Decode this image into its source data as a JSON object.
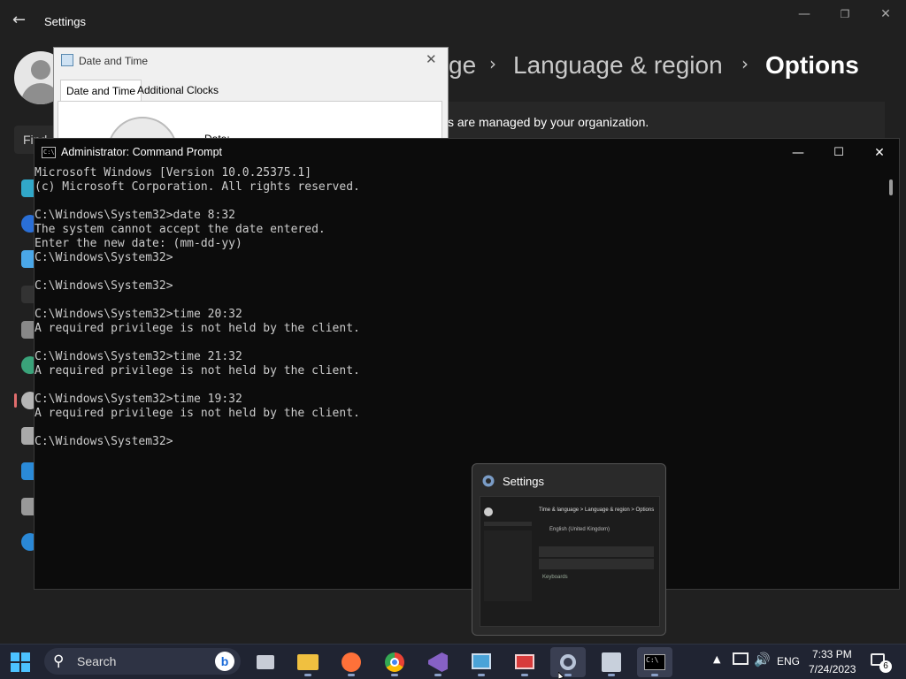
{
  "settings": {
    "app_title": "Settings",
    "find_placeholder": "Find",
    "breadcrumb": [
      "ge",
      "Language & region",
      "Options"
    ],
    "org_message": "s are managed by your organization."
  },
  "datetime_dialog": {
    "title": "Date and Time",
    "tabs": [
      "Date and Time",
      "Additional Clocks"
    ],
    "date_label": "Date:"
  },
  "cmd": {
    "title": "Administrator: Command Prompt",
    "icon_text": "C:\\",
    "lines": [
      "Microsoft Windows [Version 10.0.25375.1]",
      "(c) Microsoft Corporation. All rights reserved.",
      "",
      "C:\\Windows\\System32>date 8:32",
      "The system cannot accept the date entered.",
      "Enter the new date: (mm-dd-yy)",
      "C:\\Windows\\System32>",
      "",
      "C:\\Windows\\System32>",
      "",
      "C:\\Windows\\System32>time 20:32",
      "A required privilege is not held by the client.",
      "",
      "C:\\Windows\\System32>time 21:32",
      "A required privilege is not held by the client.",
      "",
      "C:\\Windows\\System32>time 19:32",
      "A required privilege is not held by the client.",
      "",
      "C:\\Windows\\System32>"
    ]
  },
  "thumbnail": {
    "title": "Settings",
    "preview_breadcrumb": "Time & language  >  Language & region  >  Options",
    "preview_language": "English (United Kingdom)",
    "preview_keyboards": "Keyboards"
  },
  "taskbar": {
    "search_label": "Search",
    "language": "ENG",
    "time": "7:33 PM",
    "date": "7/24/2023",
    "notification_count": "6"
  },
  "colors": {
    "settings_bg": "#202020",
    "console_bg": "#0c0c0c",
    "console_text": "#cccccc",
    "taskbar_bg": "#202432",
    "accent": "#0078d4"
  }
}
